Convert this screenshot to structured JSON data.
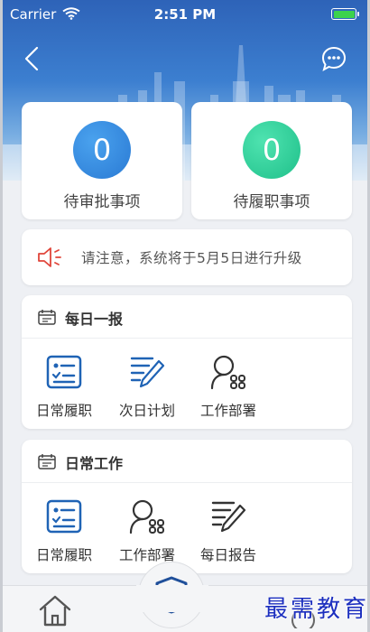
{
  "status_bar": {
    "carrier": "Carrier",
    "time": "2:51 PM"
  },
  "stats": [
    {
      "count": "0",
      "label": "待审批事项",
      "color": "#2a7ad4"
    },
    {
      "count": "0",
      "label": "待履职事项",
      "color": "#1fc08a"
    }
  ],
  "notice": {
    "text": "请注意，系统将于5月5日进行升级",
    "icon": "speaker-icon",
    "icon_color": "#e0453a"
  },
  "sections": [
    {
      "title": "每日一报",
      "items": [
        {
          "label": "日常履职",
          "icon": "checklist-icon"
        },
        {
          "label": "次日计划",
          "icon": "edit-list-icon"
        },
        {
          "label": "工作部署",
          "icon": "user-grid-icon"
        }
      ]
    },
    {
      "title": "日常工作",
      "items": [
        {
          "label": "日常履职",
          "icon": "checklist-icon"
        },
        {
          "label": "工作部署",
          "icon": "user-grid-icon"
        },
        {
          "label": "每日报告",
          "icon": "edit-list-icon"
        }
      ]
    }
  ],
  "tabbar": {
    "left_icon": "home-icon",
    "center_icon": "shield-plus-icon",
    "right_icon": "profile-icon"
  },
  "watermark": "最需教育",
  "colors": {
    "accent": "#2a6fc9",
    "icon_blue": "#1f63b5",
    "icon_dark": "#333333"
  }
}
